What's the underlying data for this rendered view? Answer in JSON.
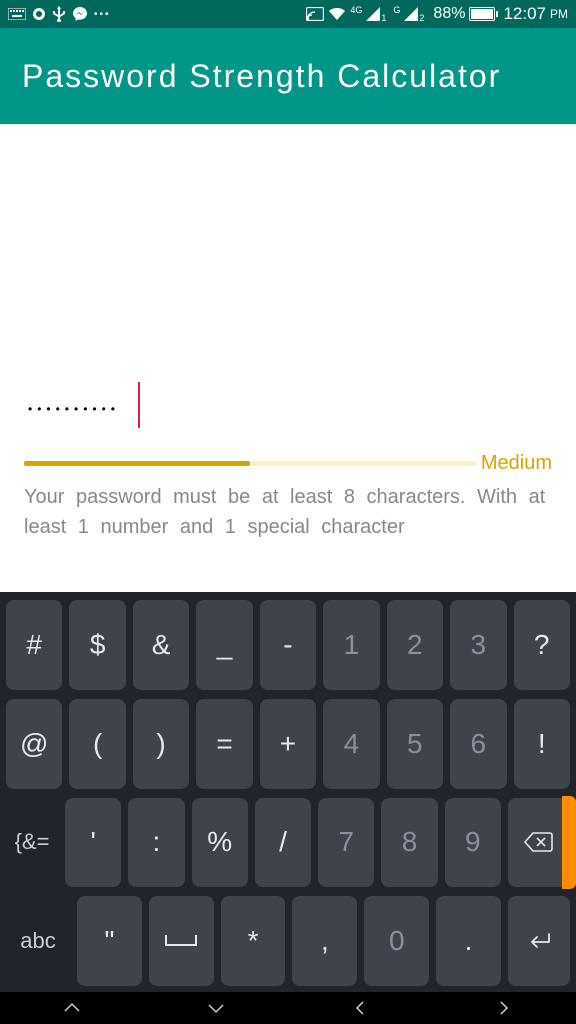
{
  "status": {
    "battery_pct": "88%",
    "time": "12:07",
    "ampm": "PM",
    "net_label_1": "4G",
    "net_label_2": "G",
    "sim1": "1",
    "sim2": "2"
  },
  "appbar": {
    "title": "Password Strength Calculator"
  },
  "password": {
    "masked": "••••••••••",
    "placeholder": ""
  },
  "strength": {
    "label": "Medium",
    "fill_pct": 50
  },
  "hint": "Your password must be at least 8 characters. With at least 1 number and 1 special character",
  "keyboard": {
    "row1": [
      "#",
      "$",
      "&",
      "_",
      "-",
      "1",
      "2",
      "3",
      "?"
    ],
    "row2": [
      "@",
      "(",
      ")",
      "=",
      "+",
      "4",
      "5",
      "6",
      "!"
    ],
    "row3_leader": "{&=",
    "row3": [
      "'",
      ":",
      "%",
      "/",
      "7",
      "8",
      "9"
    ],
    "row4_abc": "abc",
    "row4": [
      "\"",
      "␣",
      "*",
      ",",
      "0",
      "."
    ]
  },
  "colors": {
    "primary": "#009688",
    "primary_dark": "#00695c",
    "accent_warn": "#d4a800",
    "caret": "#d81b60"
  }
}
